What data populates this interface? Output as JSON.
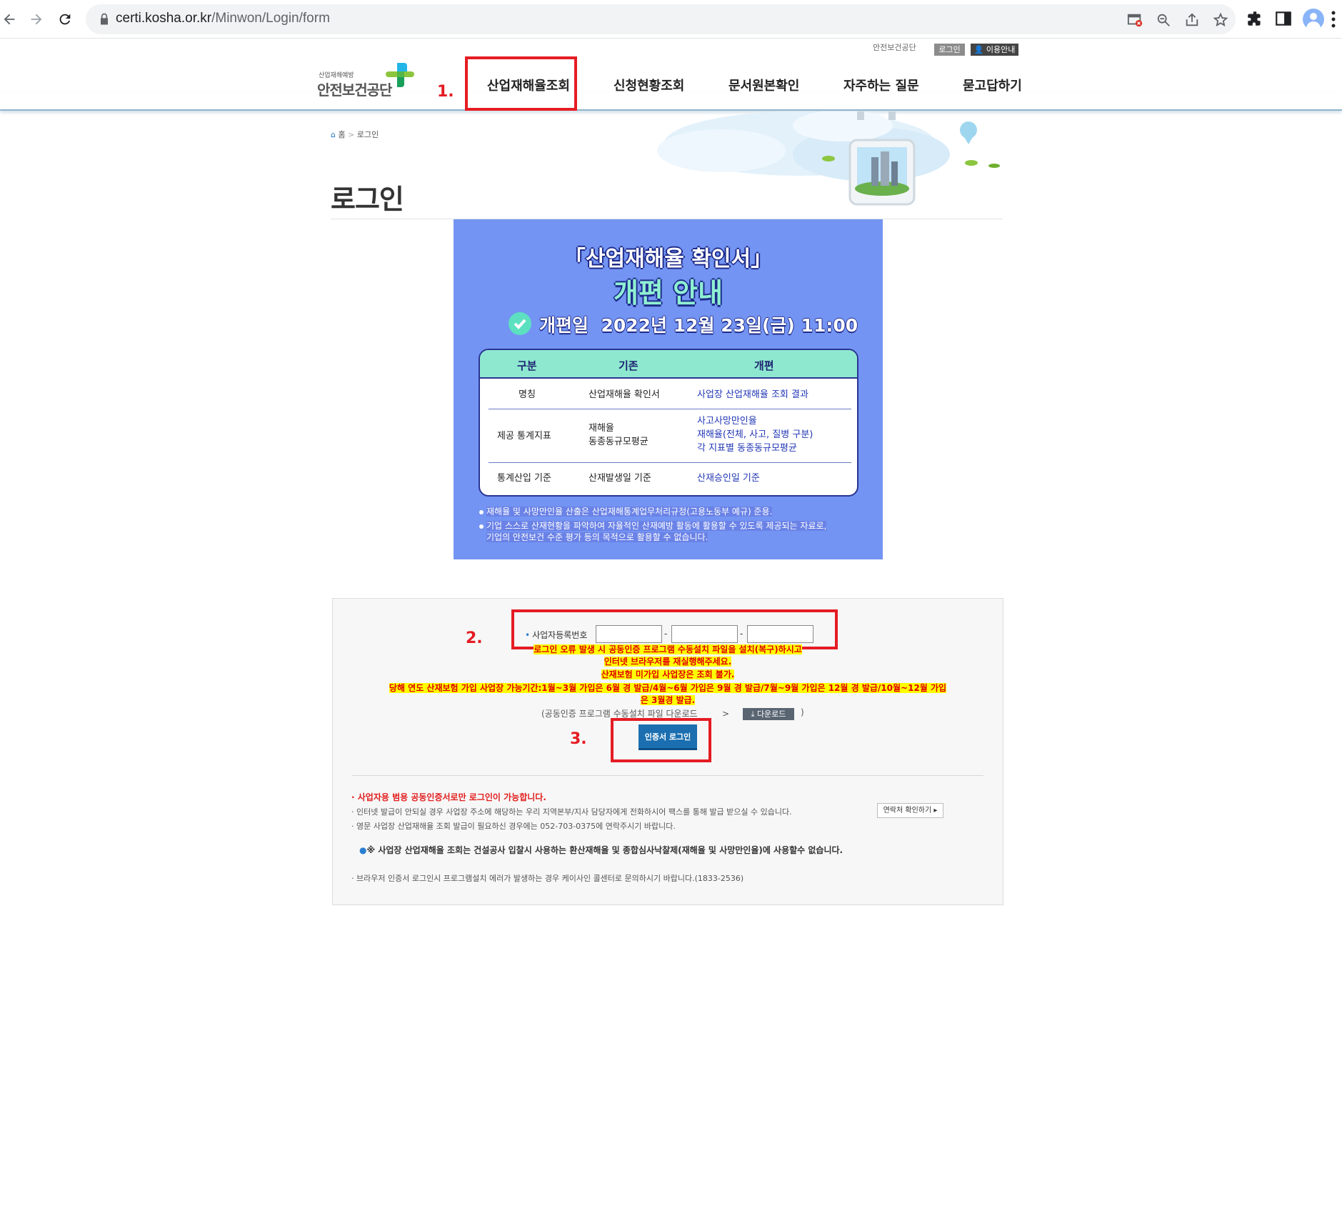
{
  "browser": {
    "url_host": "certi.kosha.or.kr",
    "url_path": "/Minwon/Login/form"
  },
  "site": {
    "top_link": "안전보건공단",
    "login_btn": "로그인",
    "guide_btn": "이용안내",
    "logo_small": "산업재해예방",
    "logo_big": "안전보건공단",
    "nav": [
      "산업재해율조회",
      "신청현황조회",
      "문서원본확인",
      "자주하는 질문",
      "묻고답하기"
    ]
  },
  "annotations": [
    "1.",
    "2.",
    "3."
  ],
  "breadcrumb": {
    "home": "홈",
    "sep": ">",
    "current": "로그인"
  },
  "page_title": "로그인",
  "banner": {
    "title1": "「산업재해율 확인서」",
    "title2": "개편 안내",
    "date_label": "개편일",
    "date_value": "2022년 12월 23일(금) 11:00",
    "headers": [
      "구분",
      "기존",
      "개편"
    ],
    "rows": [
      {
        "cat": "명칭",
        "old": "산업재해율 확인서",
        "new": "사업장 산업재해율 조회 결과"
      },
      {
        "cat": "제공 통계지표",
        "old": "재해율\n동종동규모평균",
        "new": "사고사망만인율\n재해율(전체, 사고, 질병 구분)\n각 지표별 동종동규모평균"
      },
      {
        "cat": "통계산입 기준",
        "old": "산재발생일 기준",
        "new": "산재승인일 기준"
      }
    ],
    "note1": "재해율 및 사망만인율 산출은 산업재해통계업무처리규정(고용노동부 예규) 준용.",
    "note2a": "기업 스스로 산재현황을 파악하여 자율적인 산재예방 활동에 활용할 수 있도록 제공되는 자료로,",
    "note2b": "기업의 안전보건 수준 평가 등의 목적으로 활용할 수 없습니다."
  },
  "login": {
    "biz_label": "사업자등록번호",
    "biz_dash": "-",
    "warn1": "로그인 오류 발생 시 공동인증 프로그램 수동설치 파일을 설치(복구)하시고",
    "warn2": "인터넷 브라우저를 재실행해주세요.",
    "warn3": "산재보험 미가입 사업장은 조회 불가.",
    "warn4": "당해 연도 산재보험 가입 사업장 가능기간:1월~3월 가입은 6월 경 발급/4월~6월 가입은 9월 경 발급/7월~9월 가입은 12월 경 발급/10월~12월 가입",
    "warn5": "은 3월경 발급.",
    "manual_text": "(공동인증 프로그램 수동설치 파일 다운로드",
    "download_btn": "다운로드",
    "manual_close": ")",
    "cert_btn": "인증서 로그인"
  },
  "info": {
    "line1": "· 사업자용 범용 공동인증서로만 로그인이 가능합니다.",
    "line2": "· 인터넷 발급이 안되실 경우 사업장 주소에 해당하는 우리 지역본부/지사 담당자에게 전화하시어 팩스를 통해 발급 받으실 수 있습니다.",
    "contact_btn": "연락처 확인하기",
    "line3": "· 영문 사업장 산업재해율 조회 발급이 필요하신 경우에는 052-703-0375에 연락주시기 바랍니다.",
    "notice": "※ 사업장 산업재해율 조회는 건설공사 입찰시 사용하는 환산재해율 및 종합심사낙찰제(재해율 및 사망만인율)에 사용할수 없습니다.",
    "line4": "· 브라우저 인증서 로그인시 프로그램설치 에러가 발생하는 경우 케이사인 콜센터로 문의하시기 바랍니다.(1833-2536)"
  },
  "colors": {
    "accent_red": "#e51c23",
    "banner_bg": "#7394f3",
    "cert_button": "#1b6fb0"
  }
}
